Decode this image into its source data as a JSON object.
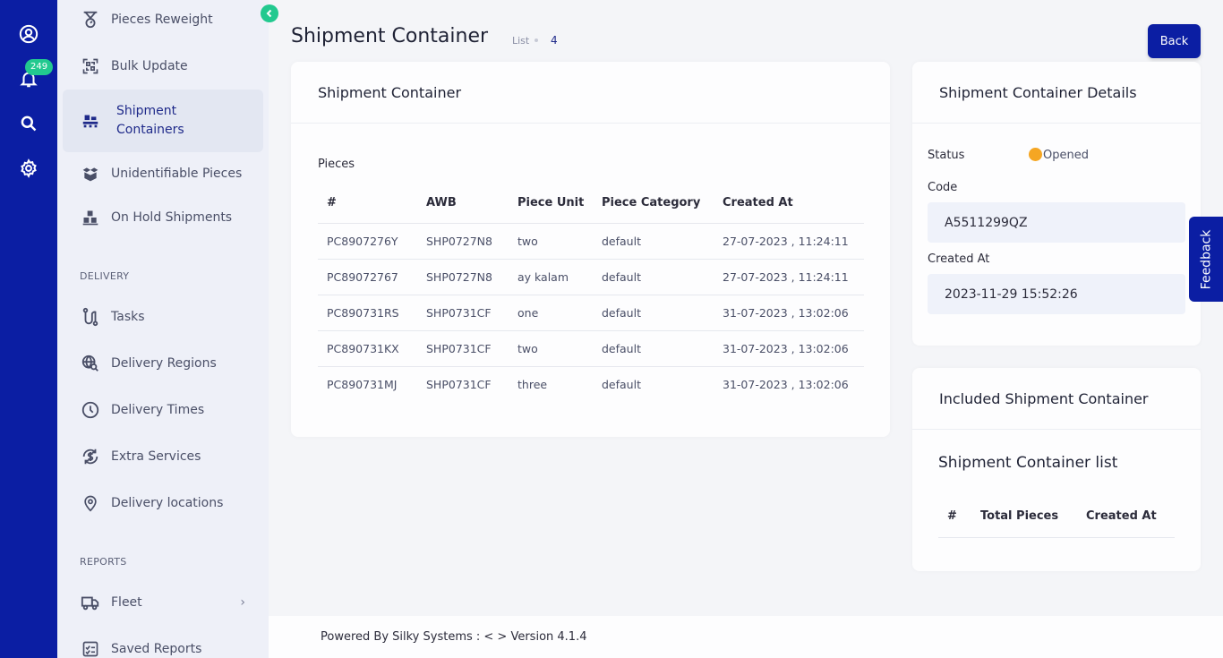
{
  "rail": {
    "notification_count": "249",
    "icons": [
      "user-circle-icon",
      "bell-icon",
      "search-icon",
      "gear-icon"
    ]
  },
  "sidebar": {
    "items_top": [
      {
        "label": "Pieces Reweight",
        "icon": "scale-icon"
      },
      {
        "label": "Bulk Update",
        "icon": "qr-scan-icon"
      },
      {
        "label": "Shipment Containers",
        "icon": "pallet-icon",
        "active": true
      },
      {
        "label": "Unidentifiable Pieces",
        "icon": "open-box-icon"
      },
      {
        "label": "On Hold Shipments",
        "icon": "stacked-boxes-icon"
      }
    ],
    "delivery_section": "DELIVERY",
    "delivery_items": [
      {
        "label": "Tasks",
        "icon": "route-icon"
      },
      {
        "label": "Delivery Regions",
        "icon": "globe-search-icon"
      },
      {
        "label": "Delivery Times",
        "icon": "clock-icon"
      },
      {
        "label": "Extra Services",
        "icon": "dollar-cycle-icon"
      },
      {
        "label": "Delivery locations",
        "icon": "map-pin-icon"
      }
    ],
    "reports_section": "REPORTS",
    "reports_items": [
      {
        "label": "Fleet",
        "icon": "truck-icon",
        "has_submenu": true
      },
      {
        "label": "Saved Reports",
        "icon": "checklist-icon"
      }
    ]
  },
  "header": {
    "title": "Shipment Container",
    "breadcrumb": "List",
    "count": "4",
    "back_label": "Back"
  },
  "pieces_card": {
    "title": "Shipment Container",
    "section_label": "Pieces",
    "columns": [
      "#",
      "AWB",
      "Piece Unit",
      "Piece Category",
      "Created At"
    ],
    "rows": [
      [
        "PC8907276Y",
        "SHP0727N8",
        "two",
        "default",
        "27-07-2023 , 11:24:11"
      ],
      [
        "PC89072767",
        "SHP0727N8",
        "ay kalam",
        "default",
        "27-07-2023 , 11:24:11"
      ],
      [
        "PC890731RS",
        "SHP0731CF",
        "one",
        "default",
        "31-07-2023 , 13:02:06"
      ],
      [
        "PC890731KX",
        "SHP0731CF",
        "two",
        "default",
        "31-07-2023 , 13:02:06"
      ],
      [
        "PC890731MJ",
        "SHP0731CF",
        "three",
        "default",
        "31-07-2023 , 13:02:06"
      ]
    ]
  },
  "details_card": {
    "title": "Shipment Container Details",
    "status_label": "Status",
    "status_value": "Opened",
    "status_color": "#f5a623",
    "code_label": "Code",
    "code_value": "A5511299QZ",
    "created_label": "Created At",
    "created_value": "2023-11-29 15:52:26"
  },
  "included_card": {
    "title": "Included Shipment Container",
    "subtitle": "Shipment Container list",
    "columns": [
      "#",
      "Total Pieces",
      "Created At"
    ]
  },
  "feedback_label": "Feedback",
  "footer": {
    "text": "Powered By Silky Systems : < > Version 4.1.4"
  },
  "colors": {
    "brand": "#0b1ea3",
    "accent": "#22c98f"
  }
}
